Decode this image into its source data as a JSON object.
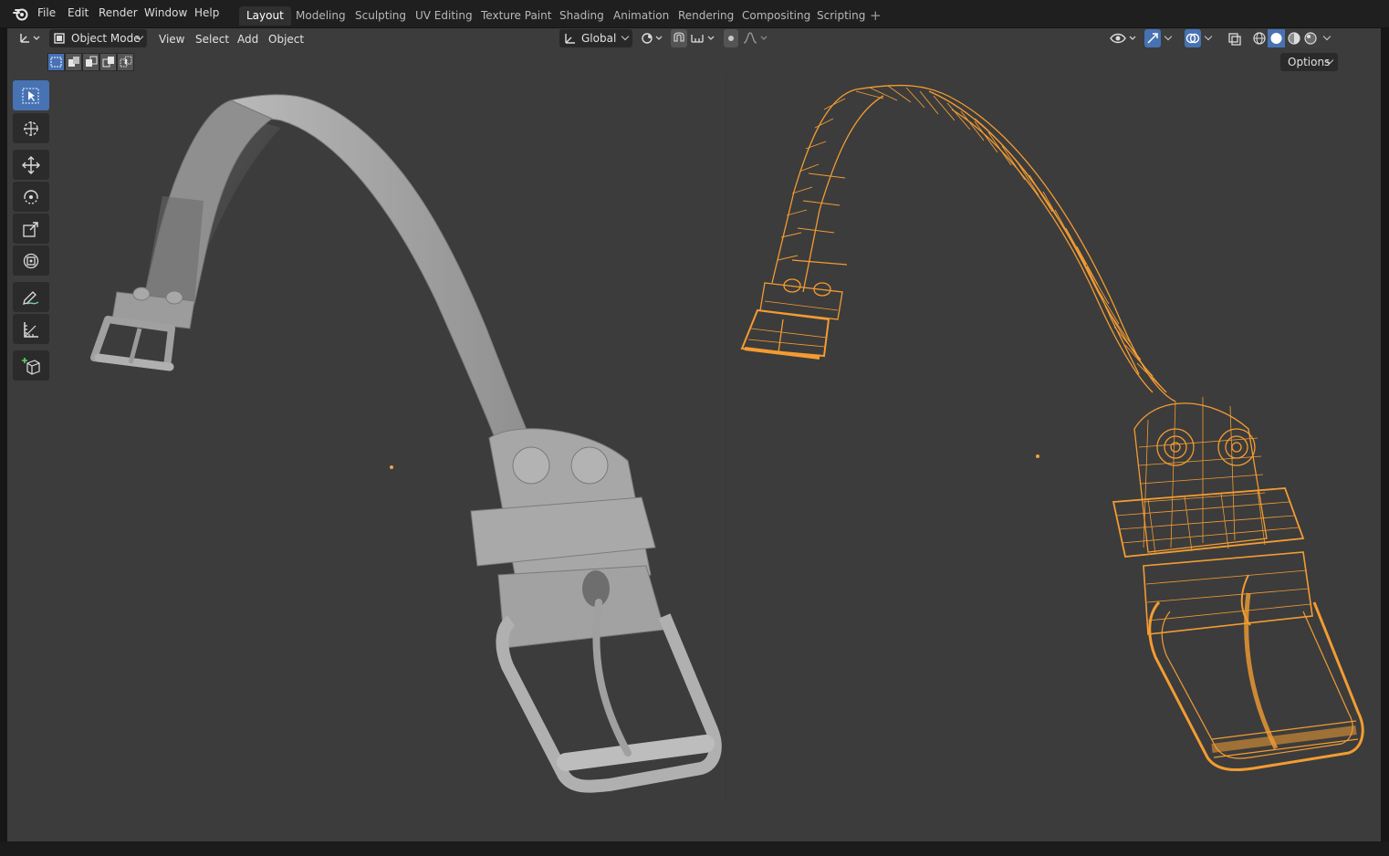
{
  "topbar": {
    "menus": [
      "File",
      "Edit",
      "Render",
      "Window",
      "Help"
    ],
    "workspaces": [
      {
        "label": "Layout",
        "active": true
      },
      {
        "label": "Modeling",
        "active": false
      },
      {
        "label": "Sculpting",
        "active": false
      },
      {
        "label": "UV Editing",
        "active": false
      },
      {
        "label": "Texture Paint",
        "active": false
      },
      {
        "label": "Shading",
        "active": false
      },
      {
        "label": "Animation",
        "active": false
      },
      {
        "label": "Rendering",
        "active": false
      },
      {
        "label": "Compositing",
        "active": false
      },
      {
        "label": "Scripting",
        "active": false
      }
    ],
    "add_workspace": "+"
  },
  "viewport_header": {
    "editor_type_icon": "axes-icon",
    "mode": "Object Mode",
    "menus": [
      "View",
      "Select",
      "Add",
      "Object"
    ],
    "transform_orientation": "Global",
    "options": "Options"
  },
  "toolbar": {
    "tools": [
      {
        "name": "select-box",
        "active": true
      },
      {
        "name": "cursor",
        "active": false
      },
      {
        "name": "move",
        "active": false
      },
      {
        "name": "rotate",
        "active": false
      },
      {
        "name": "scale",
        "active": false
      },
      {
        "name": "transform",
        "active": false
      },
      {
        "name": "annotate",
        "active": false
      },
      {
        "name": "measure",
        "active": false
      },
      {
        "name": "add-cube",
        "active": false
      }
    ]
  },
  "colors": {
    "viewport_bg": "#3c3c3c",
    "header_bg": "#1f1f1f",
    "accent_blue": "#4772b3",
    "selection_orange": "#f39c32",
    "solid_mesh": "#9a9a9a"
  }
}
